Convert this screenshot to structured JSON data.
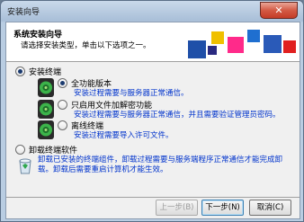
{
  "window": {
    "title": "安装向导",
    "close_glyph": "✕"
  },
  "header": {
    "title": "系统安装向导",
    "subtitle": "请选择安装类型，单击以下选项之一。"
  },
  "install": {
    "label": "安装终端",
    "options": [
      {
        "title": "全功能版本",
        "desc": "安装过程需要与服务器正常通信。",
        "selected": true
      },
      {
        "title": "只启用文件加解密功能",
        "desc": "安装过程需要与服务器正常通信，并且需要验证管理员密码。",
        "selected": false
      },
      {
        "title": "离线终端",
        "desc": "安装过程需要导入许可文件。",
        "selected": false
      }
    ]
  },
  "uninstall": {
    "label": "卸载终端软件",
    "desc": "卸载已安装的终端组件，卸载过程需要与服务端程序正常通信才能完成卸载。卸载后需要重启计算机才能生效。"
  },
  "buttons": {
    "back": "上一步(B)",
    "next": "下一步(N)",
    "cancel": "取消(C)"
  },
  "colors": {
    "accent": "#0033cc",
    "title_close": "#c43b26"
  }
}
